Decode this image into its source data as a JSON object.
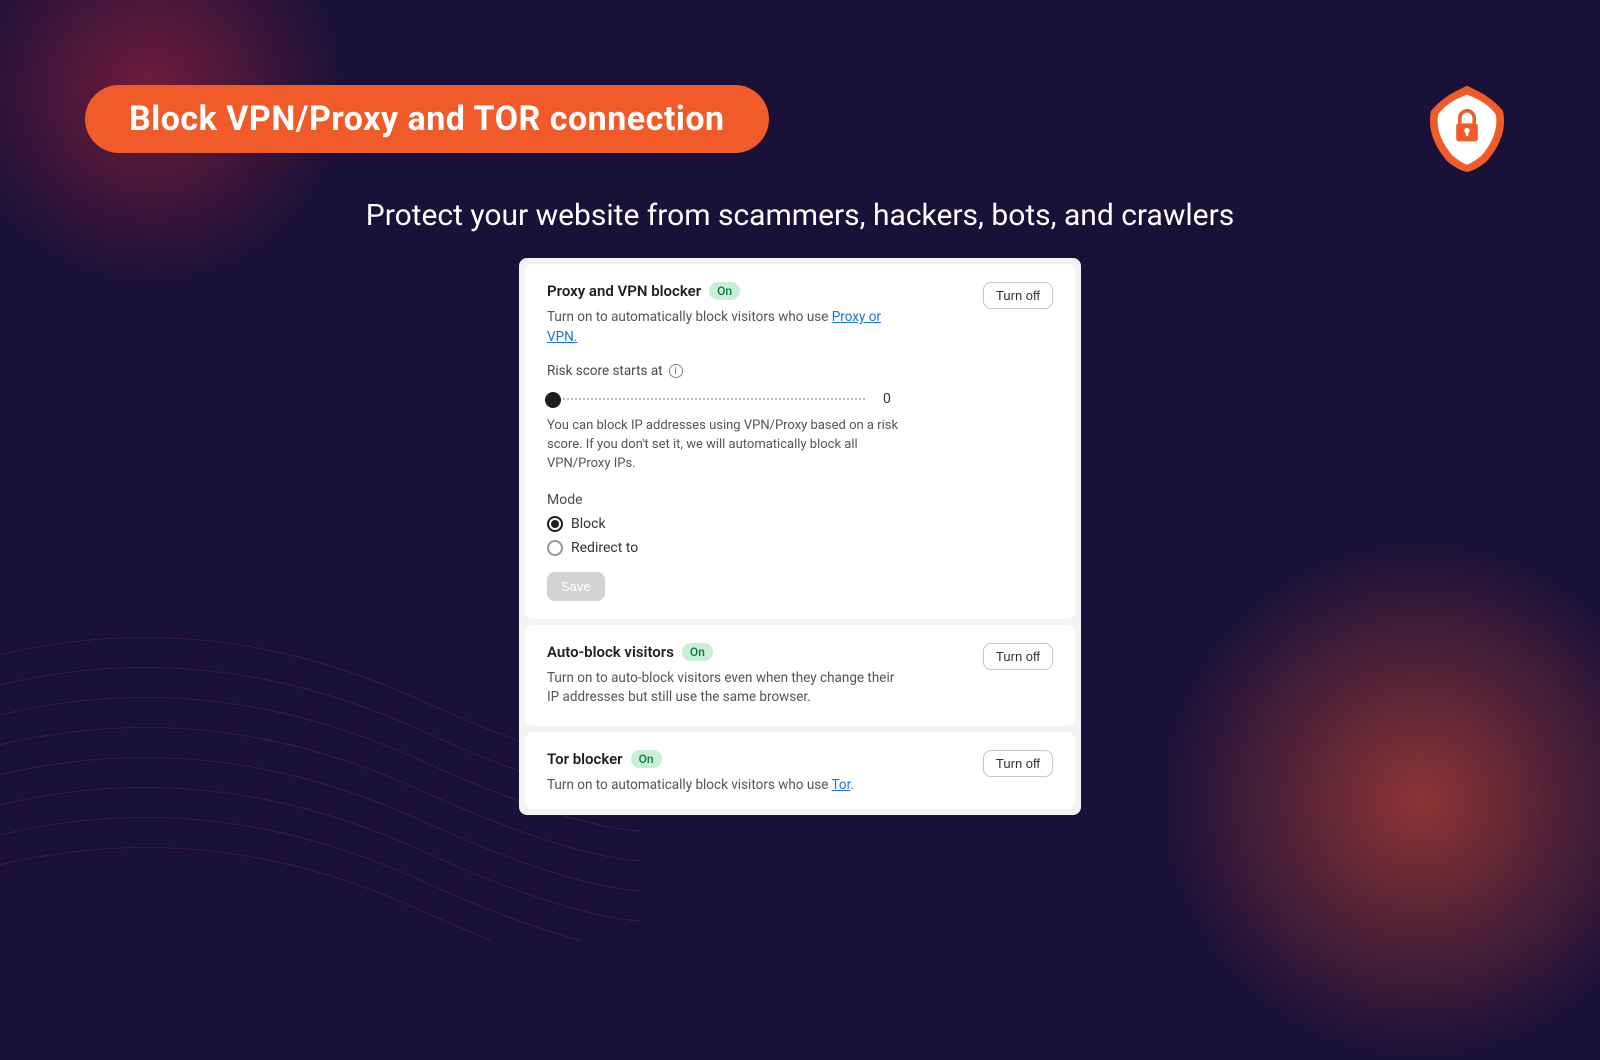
{
  "header": {
    "title": "Block VPN/Proxy and TOR connection",
    "subtitle": "Protect your website from scammers, hackers, bots, and crawlers"
  },
  "buttons": {
    "turn_off": "Turn off",
    "save": "Save"
  },
  "status": {
    "on": "On"
  },
  "proxy_card": {
    "title": "Proxy and VPN blocker",
    "desc_prefix": "Turn on to automatically block visitors who use ",
    "desc_link": "Proxy or VPN.",
    "risk_label": "Risk score starts at",
    "risk_value": "0",
    "help": "You can block IP addresses using VPN/Proxy based on a risk score. If you don't set it, we will automatically block all VPN/Proxy IPs.",
    "mode_label": "Mode",
    "mode_block": "Block",
    "mode_redirect": "Redirect to"
  },
  "autoblock_card": {
    "title": "Auto-block visitors",
    "desc": "Turn on to auto-block visitors even when they change their IP addresses but still use the same browser."
  },
  "tor_card": {
    "title": "Tor blocker",
    "desc_prefix": "Turn on to automatically block visitors who use ",
    "desc_link": "Tor"
  }
}
